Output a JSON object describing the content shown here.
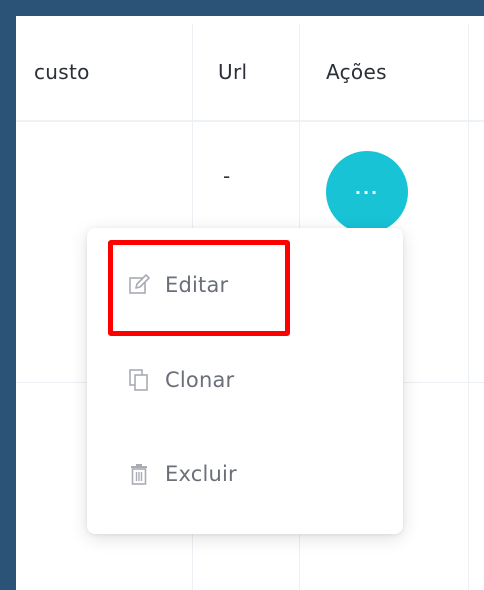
{
  "table": {
    "headers": {
      "custo": "custo",
      "url": "Url",
      "acoes": "Ações"
    },
    "row1": {
      "url": "-"
    }
  },
  "actions_button": {
    "label": "···"
  },
  "menu": {
    "items": [
      {
        "label": "Editar",
        "icon": "edit-icon"
      },
      {
        "label": "Clonar",
        "icon": "copy-icon"
      },
      {
        "label": "Excluir",
        "icon": "trash-icon"
      }
    ]
  },
  "colors": {
    "accent": "#17c3d5",
    "highlight": "#ff0000",
    "frame": "#2b5378"
  }
}
